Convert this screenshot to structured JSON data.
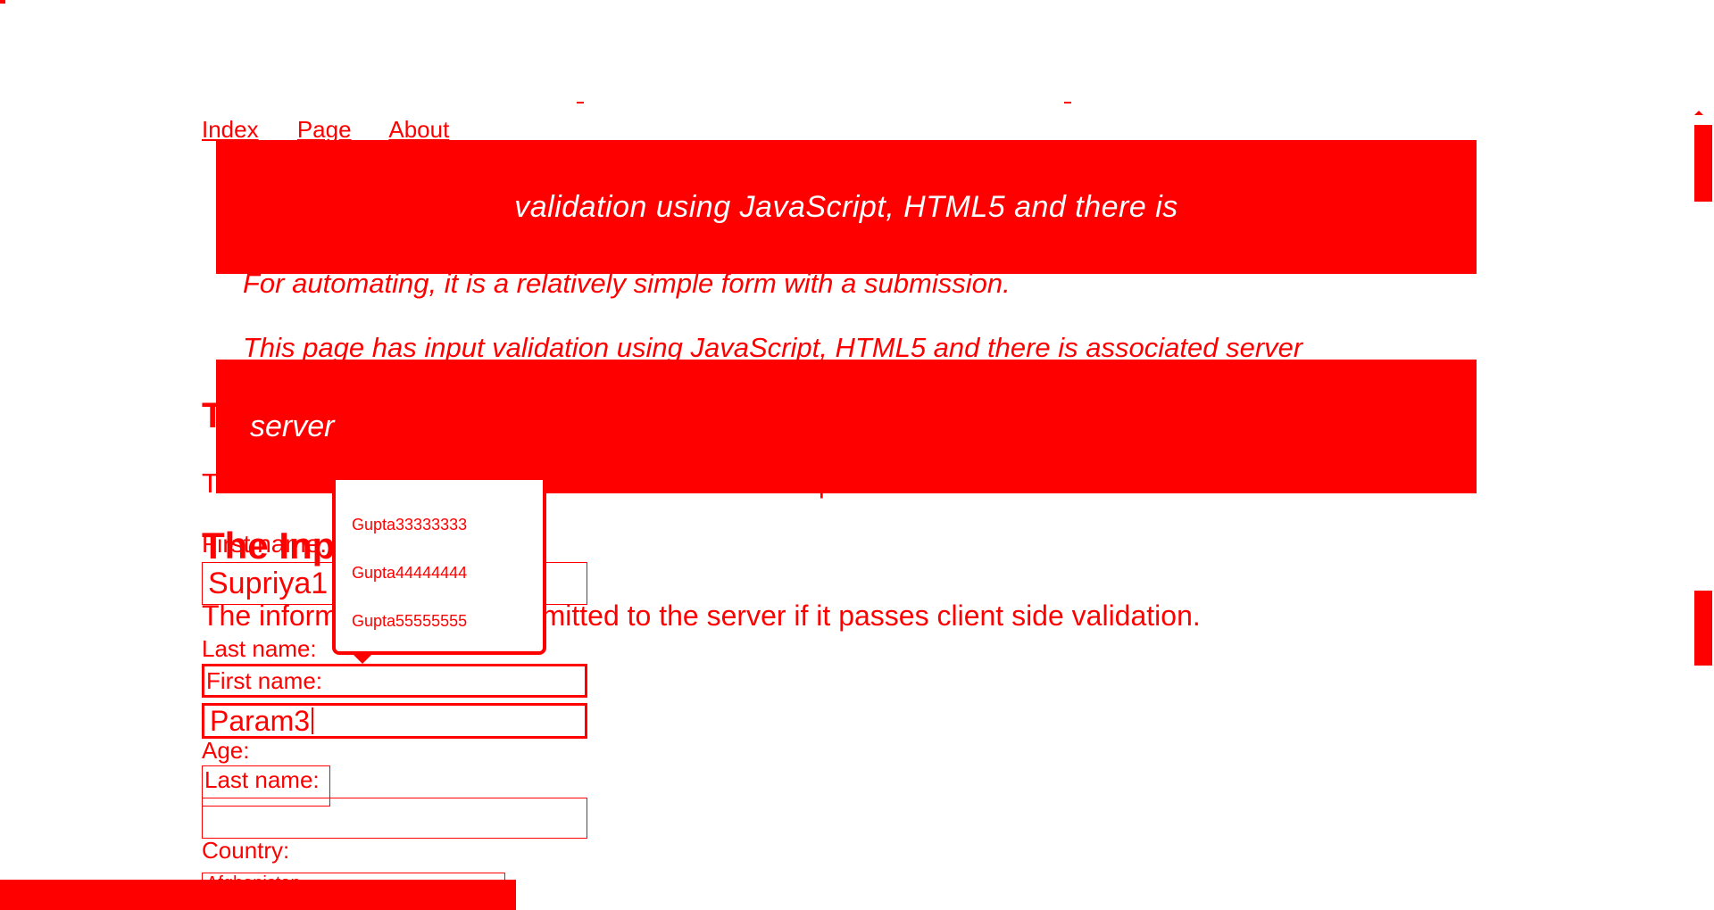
{
  "nav": {
    "items": [
      "Index",
      "Page",
      "About"
    ]
  },
  "banners": {
    "top_text": "validation using JavaScript, HTML5 and there is",
    "mid_text": "server"
  },
  "intro": {
    "line1": "For automating, it is a relatively simple form with a submission.",
    "line2": "This page has input validation using JavaScript, HTML5 and there is associated server"
  },
  "ghost": {
    "title": "T",
    "info": "The information will be submitted to the server if it passes client side validation.",
    "first_label": "First name:"
  },
  "form": {
    "title": "The Input Form",
    "info": "The information will be submitted to the server if it passes client side validation.",
    "first_old_value": "Supriya1",
    "last_label_top": "Last name:",
    "first_label": "First name:",
    "first_value": "Param3",
    "age_label": "Age:",
    "last_label": "Last name:",
    "last_value": "",
    "country_label": "Country:",
    "country_value": "Afghanistan"
  },
  "autocomplete": {
    "items": [
      "Gupta33333333",
      "Gupta44444444",
      "Gupta55555555"
    ]
  },
  "colors": {
    "accent": "#ff0000",
    "background": "#ffffff"
  }
}
